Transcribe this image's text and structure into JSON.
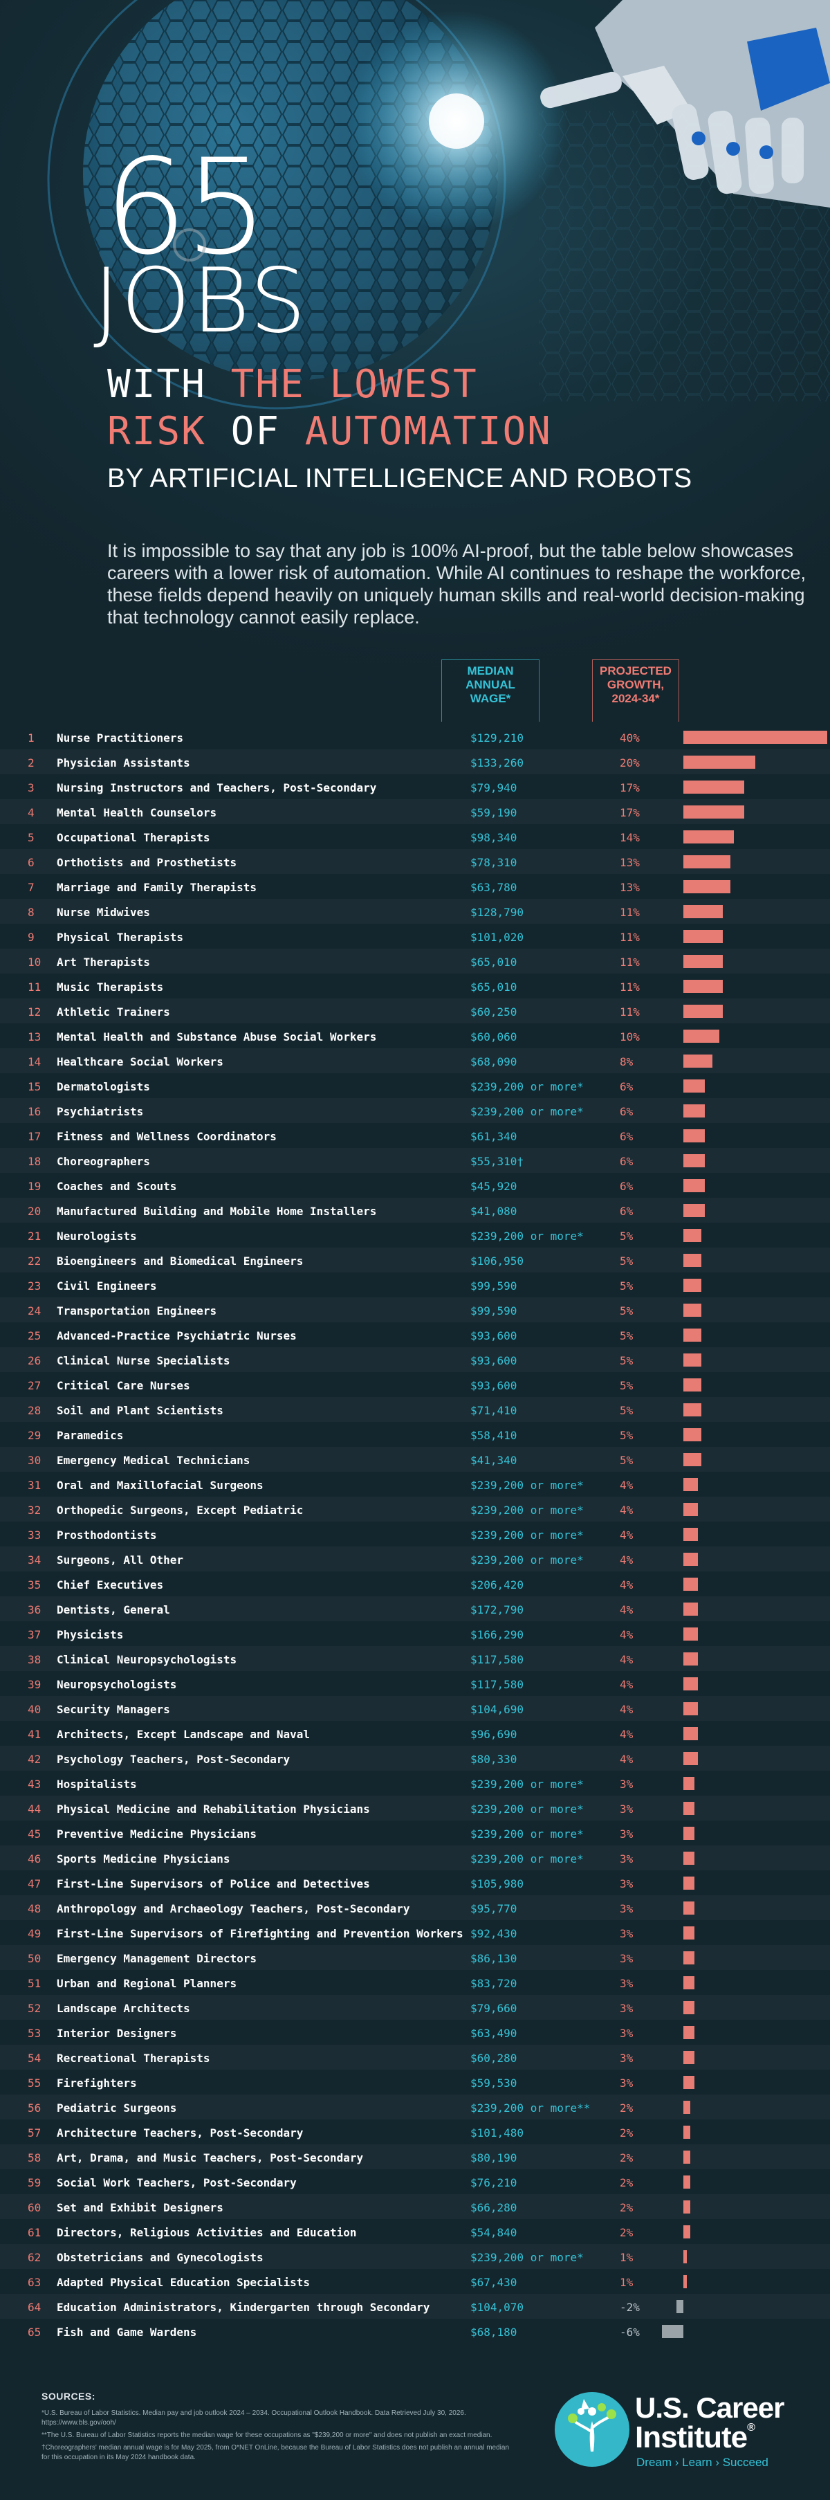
{
  "header": {
    "number": "65",
    "jobs": "JOBS",
    "line1_white": "WITH",
    "line1_pink": "THE LOWEST",
    "line2_pink_a": "RISK",
    "line2_white": "OF",
    "line2_pink_b": "AUTOMATION",
    "subtitle": "BY ARTIFICIAL INTELLIGENCE AND ROBOTS"
  },
  "intro": "It is impossible to say that any job is 100% AI-proof, but the table below showcases careers with a lower risk of automation. While AI continues to reshape the workforce, these fields depend heavily on uniquely human skills and real-world decision-making that technology cannot easily replace.",
  "columns": {
    "wage": [
      "MEDIAN",
      "ANNUAL",
      "WAGE*"
    ],
    "growth": [
      "PROJECTED",
      "GROWTH,",
      "2024-34*"
    ]
  },
  "colors": {
    "accent_pink": "#f07c74",
    "accent_teal": "#35c3d7",
    "bar": "#e77c74",
    "bar_negative": "#9aa3a8",
    "background": "#14262e"
  },
  "chart_data": {
    "type": "bar",
    "orientation": "horizontal",
    "xlim": [
      -6,
      40
    ],
    "rows": [
      {
        "rank": "1",
        "occupation": "Nurse Practitioners",
        "wage": "$129,210",
        "growth_label": "40%",
        "growth": 40
      },
      {
        "rank": "2",
        "occupation": "Physician Assistants",
        "wage": "$133,260",
        "growth_label": "20%",
        "growth": 20
      },
      {
        "rank": "3",
        "occupation": "Nursing Instructors and Teachers, Post-Secondary",
        "wage": "$79,940",
        "growth_label": "17%",
        "growth": 17
      },
      {
        "rank": "4",
        "occupation": "Mental Health Counselors",
        "wage": "$59,190",
        "growth_label": "17%",
        "growth": 17
      },
      {
        "rank": "5",
        "occupation": "Occupational Therapists",
        "wage": "$98,340",
        "growth_label": "14%",
        "growth": 14
      },
      {
        "rank": "6",
        "occupation": "Orthotists and Prosthetists",
        "wage": "$78,310",
        "growth_label": "13%",
        "growth": 13
      },
      {
        "rank": "7",
        "occupation": "Marriage and Family Therapists",
        "wage": "$63,780",
        "growth_label": "13%",
        "growth": 13
      },
      {
        "rank": "8",
        "occupation": "Nurse Midwives",
        "wage": "$128,790",
        "growth_label": "11%",
        "growth": 11
      },
      {
        "rank": "9",
        "occupation": "Physical Therapists",
        "wage": "$101,020",
        "growth_label": "11%",
        "growth": 11
      },
      {
        "rank": "10",
        "occupation": "Art Therapists",
        "wage": "$65,010",
        "growth_label": "11%",
        "growth": 11
      },
      {
        "rank": "11",
        "occupation": "Music Therapists",
        "wage": "$65,010",
        "growth_label": "11%",
        "growth": 11
      },
      {
        "rank": "12",
        "occupation": "Athletic Trainers",
        "wage": "$60,250",
        "growth_label": "11%",
        "growth": 11
      },
      {
        "rank": "13",
        "occupation": "Mental Health and Substance Abuse Social Workers",
        "wage": "$60,060",
        "growth_label": "10%",
        "growth": 10
      },
      {
        "rank": "14",
        "occupation": "Healthcare Social Workers",
        "wage": "$68,090",
        "growth_label": "8%",
        "growth": 8
      },
      {
        "rank": "15",
        "occupation": "Dermatologists",
        "wage": "$239,200 or more*",
        "growth_label": "6%",
        "growth": 6
      },
      {
        "rank": "16",
        "occupation": "Psychiatrists",
        "wage": "$239,200 or more*",
        "growth_label": "6%",
        "growth": 6
      },
      {
        "rank": "17",
        "occupation": "Fitness and Wellness Coordinators",
        "wage": "$61,340",
        "growth_label": "6%",
        "growth": 6
      },
      {
        "rank": "18",
        "occupation": "Choreographers",
        "wage": "$55,310†",
        "growth_label": "6%",
        "growth": 6
      },
      {
        "rank": "19",
        "occupation": "Coaches and Scouts",
        "wage": "$45,920",
        "growth_label": "6%",
        "growth": 6
      },
      {
        "rank": "20",
        "occupation": "Manufactured Building and Mobile Home Installers",
        "wage": "$41,080",
        "growth_label": "6%",
        "growth": 6
      },
      {
        "rank": "21",
        "occupation": "Neurologists",
        "wage": "$239,200 or more*",
        "growth_label": "5%",
        "growth": 5
      },
      {
        "rank": "22",
        "occupation": "Bioengineers and Biomedical Engineers",
        "wage": "$106,950",
        "growth_label": "5%",
        "growth": 5
      },
      {
        "rank": "23",
        "occupation": "Civil Engineers",
        "wage": "$99,590",
        "growth_label": "5%",
        "growth": 5
      },
      {
        "rank": "24",
        "occupation": "Transportation Engineers",
        "wage": "$99,590",
        "growth_label": "5%",
        "growth": 5
      },
      {
        "rank": "25",
        "occupation": "Advanced-Practice Psychiatric Nurses",
        "wage": "$93,600",
        "growth_label": "5%",
        "growth": 5
      },
      {
        "rank": "26",
        "occupation": "Clinical Nurse Specialists",
        "wage": "$93,600",
        "growth_label": "5%",
        "growth": 5
      },
      {
        "rank": "27",
        "occupation": "Critical Care Nurses",
        "wage": "$93,600",
        "growth_label": "5%",
        "growth": 5
      },
      {
        "rank": "28",
        "occupation": "Soil and Plant Scientists",
        "wage": "$71,410",
        "growth_label": "5%",
        "growth": 5
      },
      {
        "rank": "29",
        "occupation": "Paramedics",
        "wage": "$58,410",
        "growth_label": "5%",
        "growth": 5
      },
      {
        "rank": "30",
        "occupation": "Emergency Medical Technicians",
        "wage": "$41,340",
        "growth_label": "5%",
        "growth": 5
      },
      {
        "rank": "31",
        "occupation": "Oral and Maxillofacial Surgeons",
        "wage": "$239,200 or more*",
        "growth_label": "4%",
        "growth": 4
      },
      {
        "rank": "32",
        "occupation": "Orthopedic Surgeons, Except Pediatric",
        "wage": "$239,200 or more*",
        "growth_label": "4%",
        "growth": 4
      },
      {
        "rank": "33",
        "occupation": "Prosthodontists",
        "wage": "$239,200 or more*",
        "growth_label": "4%",
        "growth": 4
      },
      {
        "rank": "34",
        "occupation": "Surgeons, All Other",
        "wage": "$239,200 or more*",
        "growth_label": "4%",
        "growth": 4
      },
      {
        "rank": "35",
        "occupation": "Chief Executives",
        "wage": "$206,420",
        "growth_label": "4%",
        "growth": 4
      },
      {
        "rank": "36",
        "occupation": "Dentists, General",
        "wage": "$172,790",
        "growth_label": "4%",
        "growth": 4
      },
      {
        "rank": "37",
        "occupation": "Physicists",
        "wage": "$166,290",
        "growth_label": "4%",
        "growth": 4
      },
      {
        "rank": "38",
        "occupation": "Clinical Neuropsychologists",
        "wage": "$117,580",
        "growth_label": "4%",
        "growth": 4
      },
      {
        "rank": "39",
        "occupation": "Neuropsychologists",
        "wage": "$117,580",
        "growth_label": "4%",
        "growth": 4
      },
      {
        "rank": "40",
        "occupation": "Security Managers",
        "wage": "$104,690",
        "growth_label": "4%",
        "growth": 4
      },
      {
        "rank": "41",
        "occupation": "Architects, Except Landscape and Naval",
        "wage": "$96,690",
        "growth_label": "4%",
        "growth": 4
      },
      {
        "rank": "42",
        "occupation": "Psychology Teachers, Post-Secondary",
        "wage": "$80,330",
        "growth_label": "4%",
        "growth": 4
      },
      {
        "rank": "43",
        "occupation": "Hospitalists",
        "wage": "$239,200 or more*",
        "growth_label": "3%",
        "growth": 3
      },
      {
        "rank": "44",
        "occupation": "Physical Medicine and Rehabilitation Physicians",
        "wage": "$239,200 or more*",
        "growth_label": "3%",
        "growth": 3
      },
      {
        "rank": "45",
        "occupation": "Preventive Medicine Physicians",
        "wage": "$239,200 or more*",
        "growth_label": "3%",
        "growth": 3
      },
      {
        "rank": "46",
        "occupation": "Sports Medicine Physicians",
        "wage": "$239,200 or more*",
        "growth_label": "3%",
        "growth": 3
      },
      {
        "rank": "47",
        "occupation": "First-Line Supervisors of Police and Detectives",
        "wage": "$105,980",
        "growth_label": "3%",
        "growth": 3
      },
      {
        "rank": "48",
        "occupation": "Anthropology and Archaeology Teachers, Post-Secondary",
        "wage": "$95,770",
        "growth_label": "3%",
        "growth": 3
      },
      {
        "rank": "49",
        "occupation": "First-Line Supervisors of Firefighting and Prevention Workers",
        "wage": "$92,430",
        "growth_label": "3%",
        "growth": 3
      },
      {
        "rank": "50",
        "occupation": "Emergency Management Directors",
        "wage": "$86,130",
        "growth_label": "3%",
        "growth": 3
      },
      {
        "rank": "51",
        "occupation": "Urban and Regional Planners",
        "wage": "$83,720",
        "growth_label": "3%",
        "growth": 3
      },
      {
        "rank": "52",
        "occupation": "Landscape Architects",
        "wage": "$79,660",
        "growth_label": "3%",
        "growth": 3
      },
      {
        "rank": "53",
        "occupation": "Interior Designers",
        "wage": "$63,490",
        "growth_label": "3%",
        "growth": 3
      },
      {
        "rank": "54",
        "occupation": "Recreational Therapists",
        "wage": "$60,280",
        "growth_label": "3%",
        "growth": 3
      },
      {
        "rank": "55",
        "occupation": "Firefighters",
        "wage": "$59,530",
        "growth_label": "3%",
        "growth": 3
      },
      {
        "rank": "56",
        "occupation": "Pediatric Surgeons",
        "wage": "$239,200 or more**",
        "growth_label": "2%",
        "growth": 2
      },
      {
        "rank": "57",
        "occupation": "Architecture Teachers, Post-Secondary",
        "wage": "$101,480",
        "growth_label": "2%",
        "growth": 2
      },
      {
        "rank": "58",
        "occupation": "Art, Drama, and Music Teachers, Post-Secondary",
        "wage": "$80,190",
        "growth_label": "2%",
        "growth": 2
      },
      {
        "rank": "59",
        "occupation": "Social Work Teachers, Post-Secondary",
        "wage": "$76,210",
        "growth_label": "2%",
        "growth": 2
      },
      {
        "rank": "60",
        "occupation": "Set and Exhibit Designers",
        "wage": "$66,280",
        "growth_label": "2%",
        "growth": 2
      },
      {
        "rank": "61",
        "occupation": "Directors, Religious Activities and Education",
        "wage": "$54,840",
        "growth_label": "2%",
        "growth": 2
      },
      {
        "rank": "62",
        "occupation": "Obstetricians and Gynecologists",
        "wage": "$239,200 or more*",
        "growth_label": "1%",
        "growth": 1
      },
      {
        "rank": "63",
        "occupation": "Adapted Physical Education Specialists",
        "wage": "$67,430",
        "growth_label": "1%",
        "growth": 1
      },
      {
        "rank": "64",
        "occupation": "Education Administrators, Kindergarten through Secondary",
        "wage": "$104,070",
        "growth_label": "-2%",
        "growth": -2
      },
      {
        "rank": "65",
        "occupation": "Fish and Game Wardens",
        "wage": "$68,180",
        "growth_label": "-6%",
        "growth": -6
      }
    ]
  },
  "sources": {
    "heading": "SOURCES:",
    "lines": [
      "*U.S. Bureau of Labor Statistics. Median pay and job outlook 2024 – 2034. Occupational Outlook Handbook. Data Retrieved July 30, 2026. https://www.bls.gov/ooh/",
      "**The U.S. Bureau of Labor Statistics reports the median wage for these occupations as \"$239,200 or more\" and does not publish an exact median.",
      "†Choreographers' median annual wage is for May 2025, from O*NET OnLine, because the Bureau of Labor Statistics does not publish an annual median for this occupation in its May 2024 handbook data."
    ]
  },
  "brand": {
    "line1": "U.S. Career",
    "line2": "Institute",
    "registered": "®",
    "tagline": "Dream › Learn › Succeed"
  }
}
